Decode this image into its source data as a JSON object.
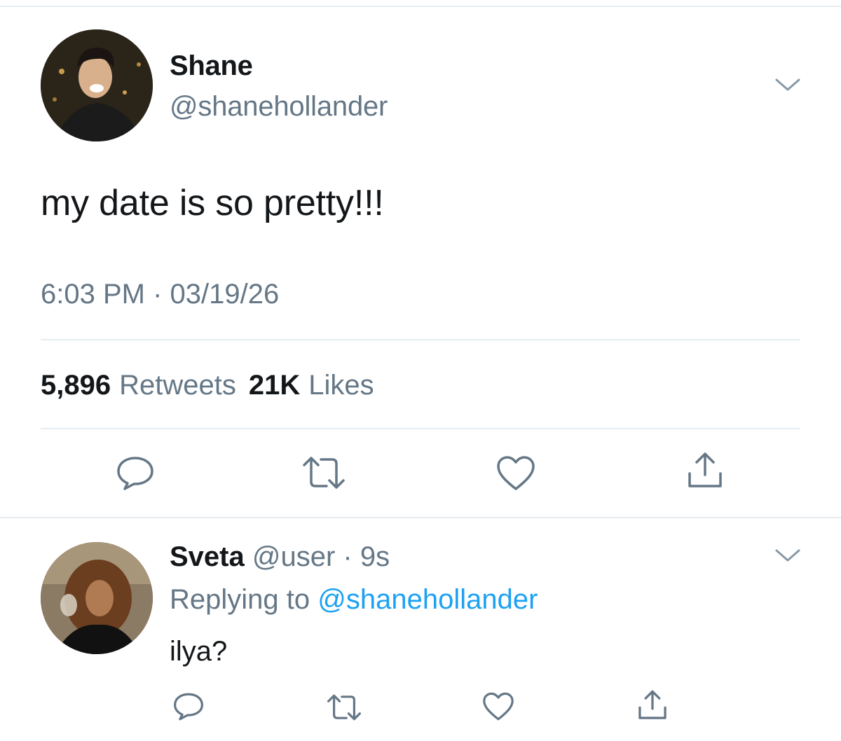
{
  "tweet": {
    "author_name": "Shane",
    "author_handle": "@shanehollander",
    "text": "my date is so pretty!!!",
    "timestamp": "6:03 PM · 03/19/26",
    "retweets_count": "5,896",
    "retweets_label": "Retweets",
    "likes_count": "21K",
    "likes_label": "Likes"
  },
  "reply": {
    "author_name": "Sveta",
    "author_handle": "@user",
    "time": "· 9s",
    "replying_prefix": "Replying to",
    "replying_handle": "@shanehollander",
    "text": "ilya?"
  },
  "icons": {
    "reply": "speech-bubble-icon",
    "retweet": "retweet-icon",
    "like": "heart-icon",
    "share": "share-icon",
    "menu": "chevron-down-icon"
  },
  "colors": {
    "text": "#14171a",
    "secondary": "#657786",
    "link": "#1da1f2",
    "divider": "#e6ecf0"
  }
}
